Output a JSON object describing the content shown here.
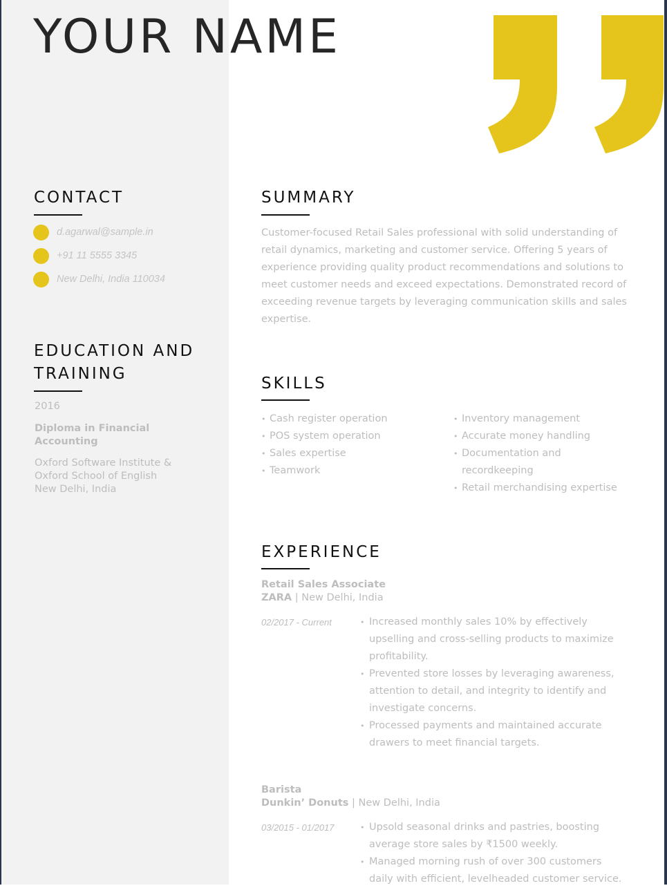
{
  "header": {
    "name": "YOUR NAME"
  },
  "accent_color": "#e5c41c",
  "contact": {
    "heading": "CONTACT",
    "items": [
      {
        "icon": "dot-icon",
        "text": "d.agarwal@sample.in"
      },
      {
        "icon": "dot-icon",
        "text": "+91 11 5555 3345"
      },
      {
        "icon": "dot-icon",
        "text": "New Delhi, India 110034"
      }
    ]
  },
  "education": {
    "heading_line1": "EDUCATION AND",
    "heading_line2": "TRAINING",
    "year": "2016",
    "degree": "Diploma in Financial Accounting",
    "school_line1": "Oxford Software Institute &",
    "school_line2": "Oxford School of English",
    "school_line3": "New Delhi, India"
  },
  "summary": {
    "heading": "SUMMARY",
    "text": "Customer-focused Retail Sales professional with solid understanding of retail dynamics, marketing and customer service. Offering 5 years of experience providing quality product recommendations and solutions to meet customer needs and exceed expectations. Demonstrated record of exceeding revenue targets by leveraging communication skills and sales expertise."
  },
  "skills": {
    "heading": "SKILLS",
    "left": [
      "Cash register operation",
      "POS system operation",
      "Sales expertise",
      "Teamwork"
    ],
    "right": [
      "Inventory management",
      "Accurate money handling",
      "Documentation and recordkeeping",
      "Retail merchandising expertise"
    ]
  },
  "experience": {
    "heading": "EXPERIENCE",
    "jobs": [
      {
        "title": "Retail Sales Associate",
        "company": "ZARA",
        "location": " | New Delhi, India",
        "dates": "02/2017 - Current",
        "bullets": [
          "Increased monthly sales 10% by effectively upselling and cross-selling products to maximize profitability.",
          "Prevented store losses by leveraging awareness, attention to detail, and integrity to identify and investigate concerns.",
          "Processed payments and maintained accurate drawers to meet financial targets."
        ]
      },
      {
        "title": "Barista",
        "company": "Dunkin’ Donuts",
        "location": " | New Delhi, India",
        "dates": "03/2015 - 01/2017",
        "bullets": [
          "Upsold seasonal drinks and pastries, boosting average store sales by ₹1500 weekly.",
          "Managed morning rush of over 300 customers daily with efficient, levelheaded customer service."
        ]
      }
    ]
  }
}
